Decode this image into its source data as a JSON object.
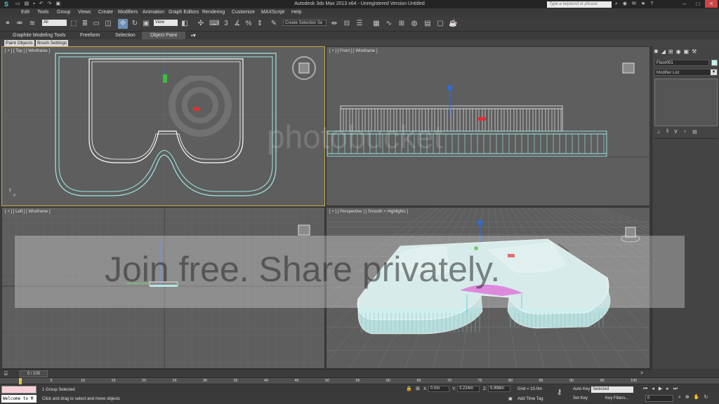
{
  "titlebar": {
    "title": "Autodesk 3ds Max 2013 x64 - Unregistered Version   Untitled",
    "search_placeholder": "Type a keyword or phrase",
    "app_logo": "3ds-max-logo",
    "minimize": "–",
    "maximize": "□",
    "close": "✕"
  },
  "menu": [
    "Edit",
    "Tools",
    "Group",
    "Views",
    "Create",
    "Modifiers",
    "Animation",
    "Graph Editors",
    "Rendering",
    "Customize",
    "MAXScript",
    "Help"
  ],
  "toolbar": {
    "selection_filter": "All",
    "reference_coord": "View",
    "named_selection": "Create Selection Se"
  },
  "ribbon": {
    "tabs": [
      "Graphite Modeling Tools",
      "Freeform",
      "Selection",
      "Object Paint"
    ],
    "active_tab": "Object Paint",
    "subtabs": [
      "Paint Objects",
      "Brush Settings"
    ]
  },
  "viewports": {
    "top": "[ + ] [ Top ] [ Wireframe ]",
    "front": "[ + ] [ Front ] [ Wireframe ]",
    "left": "[ + ] [ Left ] [ Wireframe ]",
    "perspective": "[ + ] [ Perspective ] [ Smooth + Highlights ]"
  },
  "command_panel": {
    "object_name": "Floor001",
    "object_color": "#c8f2ee",
    "modifier_list": "Modifier List"
  },
  "timeline": {
    "frame_display": "0 / 100",
    "ticks": [
      "0",
      "5",
      "10",
      "15",
      "20",
      "25",
      "30",
      "35",
      "40",
      "45",
      "50",
      "55",
      "60",
      "65",
      "70",
      "75",
      "80",
      "85",
      "90",
      "95",
      "100"
    ]
  },
  "status": {
    "listener_text": "Welcome to M",
    "selection_info": "1 Group Selected",
    "prompt": "Click and drag to select and move objects",
    "x_label": "X:",
    "x_value": "0.0m",
    "y_label": "Y:",
    "y_value": "3.224m",
    "z_label": "Z:",
    "z_value": "5.998m",
    "grid": "Grid = 10.0m",
    "add_time_tag": "Add Time Tag",
    "auto_key": "Auto Key",
    "auto_key_mode": "Selected",
    "set_key": "Set Key",
    "key_filters": "Key Filters...",
    "current_frame": "0"
  },
  "watermark": {
    "line1": "photobucket",
    "line2": "Join free. Share privately."
  },
  "colors": {
    "wireframe": "#9fe8e4",
    "selected_wire": "#ffffff",
    "mesh_fill": "#cfeeed",
    "magenta": "#d95ad9",
    "active_border": "#c9a94a"
  }
}
